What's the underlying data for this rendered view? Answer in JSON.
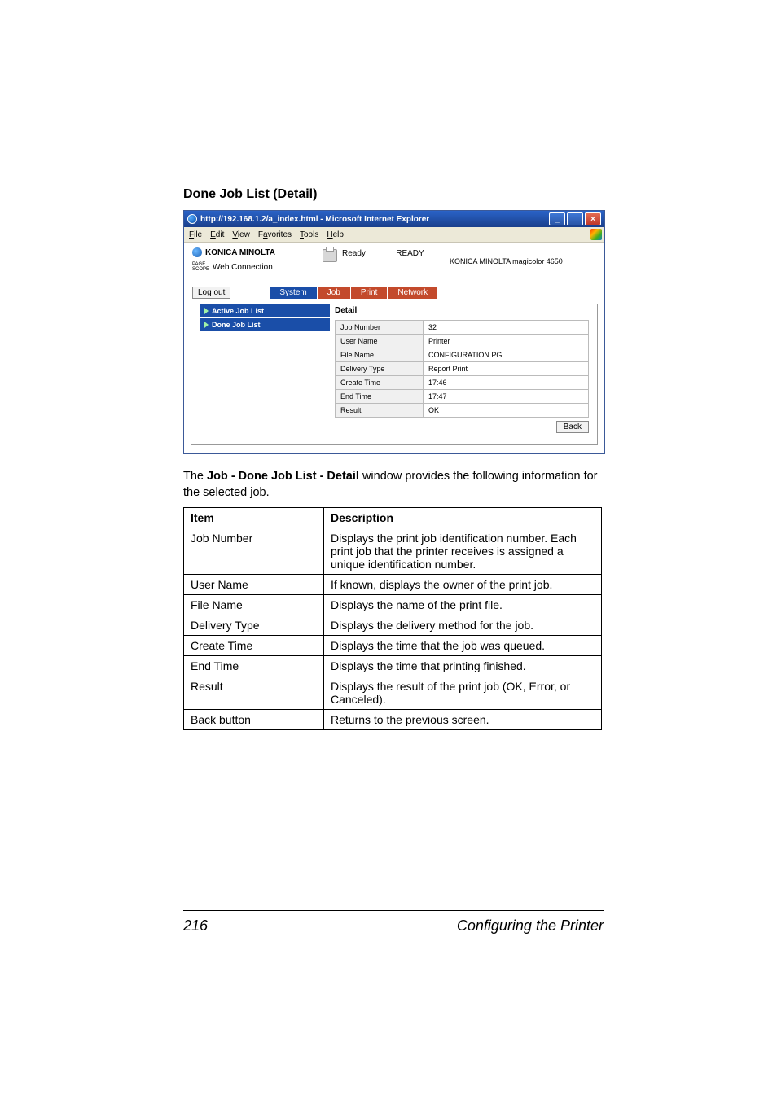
{
  "heading": "Done Job List (Detail)",
  "screenshot": {
    "window_title": "http://192.168.1.2/a_index.html - Microsoft Internet Explorer",
    "menubar": [
      "File",
      "Edit",
      "View",
      "Favorites",
      "Tools",
      "Help"
    ],
    "brand1": "KONICA MINOLTA",
    "brand2_a": "PAGE",
    "brand2_b": "SCOPE",
    "brand2_label": "Web Connection",
    "status_label": "Ready",
    "status_title": "READY",
    "device_name": "KONICA MINOLTA magicolor 4650",
    "logout": "Log out",
    "tabs": [
      "System",
      "Job",
      "Print",
      "Network"
    ],
    "active_tab_index": 0,
    "left_links": [
      "Active Job List",
      "Done Job List"
    ],
    "detail_label": "Detail",
    "rows": [
      {
        "k": "Job Number",
        "v": "32"
      },
      {
        "k": "User Name",
        "v": "Printer"
      },
      {
        "k": "File Name",
        "v": "CONFIGURATION PG"
      },
      {
        "k": "Delivery Type",
        "v": "Report Print"
      },
      {
        "k": "Create Time",
        "v": "17:46"
      },
      {
        "k": "End Time",
        "v": "17:47"
      },
      {
        "k": "Result",
        "v": "OK"
      }
    ],
    "back_label": "Back"
  },
  "intro_a": "The ",
  "intro_b": "Job - Done Job List - Detail",
  "intro_c": " window provides the following information for the selected job.",
  "doc_table": {
    "header": [
      "Item",
      "Description"
    ],
    "rows": [
      [
        "Job Number",
        "Displays the print job identification number. Each print job that the printer receives is assigned a unique identification number."
      ],
      [
        "User Name",
        "If known, displays the owner of the print job."
      ],
      [
        "File Name",
        "Displays the name of the print file."
      ],
      [
        "Delivery Type",
        "Displays the delivery method for the job."
      ],
      [
        "Create Time",
        "Displays the time that the job was queued."
      ],
      [
        "End Time",
        "Displays the time that printing finished."
      ],
      [
        "Result",
        "Displays the result of the print job (OK, Error, or Canceled)."
      ],
      [
        "Back button",
        "Returns to the previous screen."
      ]
    ]
  },
  "footer": {
    "page": "216",
    "section": "Configuring the Printer"
  }
}
